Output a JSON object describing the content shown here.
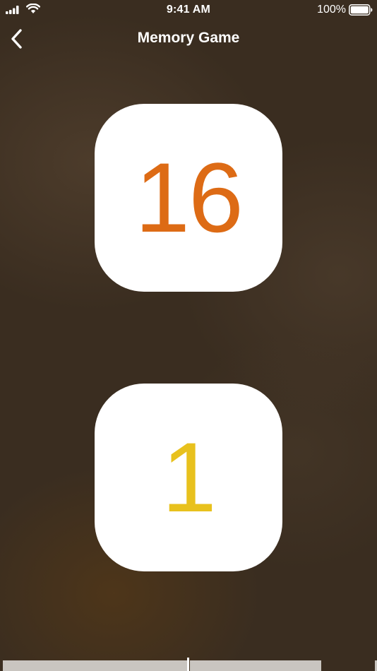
{
  "status_bar": {
    "time": "9:41 AM",
    "battery_percent": "100%",
    "icons": [
      "signal-icon",
      "wifi-icon",
      "battery-icon"
    ]
  },
  "nav": {
    "title": "Memory Game",
    "back_icon": "chevron-left-icon"
  },
  "cards": [
    {
      "value": "16",
      "color": "#dd6b15"
    },
    {
      "value": "1",
      "color": "#e8c11d"
    }
  ],
  "colors": {
    "background": "#3a2d20",
    "card": "#ffffff",
    "strip": "#c9c5c0"
  }
}
